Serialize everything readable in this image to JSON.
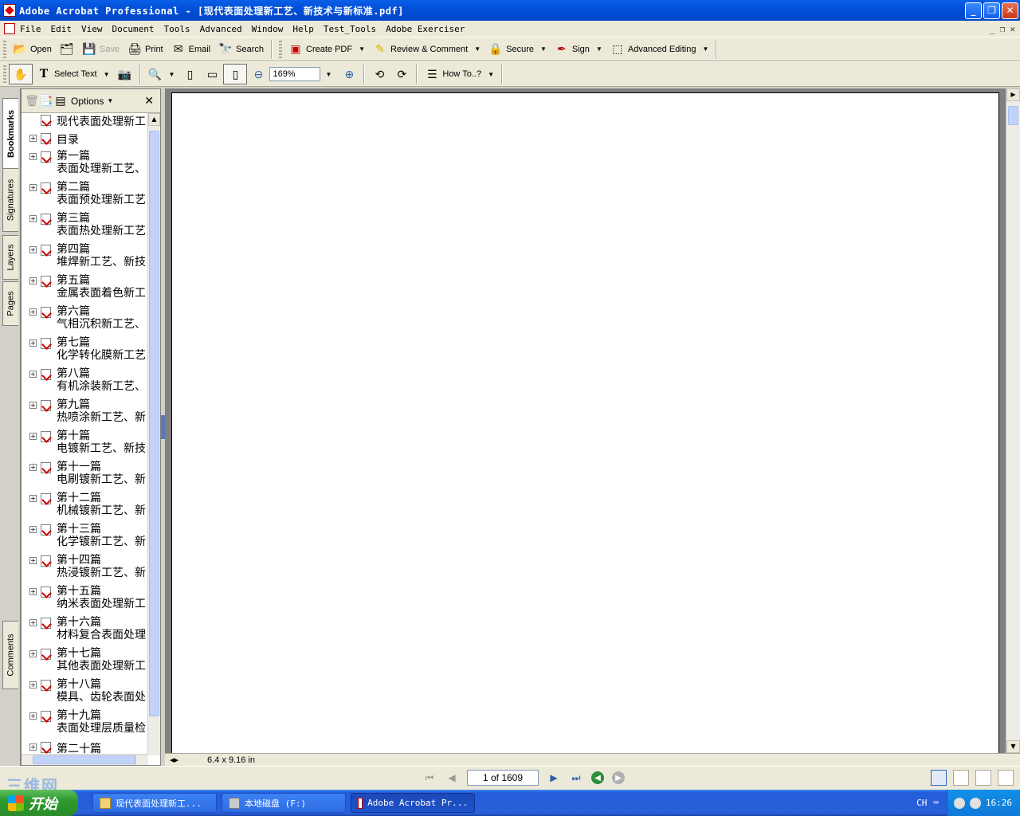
{
  "window": {
    "title": "Adobe Acrobat Professional - [现代表面处理新工艺、新技术与新标准.pdf]",
    "minimize": "_",
    "maximize": "❐",
    "close": "✕"
  },
  "menu": {
    "items": [
      "File",
      "Edit",
      "View",
      "Document",
      "Tools",
      "Advanced",
      "Window",
      "Help",
      "Test_Tools",
      "Adobe Exerciser"
    ],
    "mdi_buttons": [
      "_",
      "❐",
      "✕"
    ]
  },
  "toolbar1": {
    "open": "Open",
    "save": "Save",
    "print": "Print",
    "email": "Email",
    "search": "Search",
    "create_pdf": "Create PDF",
    "review_comment": "Review & Comment",
    "secure": "Secure",
    "sign": "Sign",
    "advanced_editing": "Advanced Editing"
  },
  "toolbar2": {
    "select_text": "Select Text",
    "zoom_value": "169%",
    "how_to": "How To..?"
  },
  "nav_tabs": [
    "Bookmarks",
    "Signatures",
    "Layers",
    "Pages",
    "Comments"
  ],
  "bookmarks_panel": {
    "options": "Options",
    "close": "✕",
    "items": [
      {
        "line1": "现代表面处理新工",
        "line2": ""
      },
      {
        "line1": "目录",
        "line2": ""
      },
      {
        "line1": "第一篇",
        "line2": "表面处理新工艺、"
      },
      {
        "line1": "第二篇",
        "line2": "表面预处理新工艺"
      },
      {
        "line1": "第三篇",
        "line2": "表面热处理新工艺"
      },
      {
        "line1": "第四篇",
        "line2": "堆焊新工艺、新技"
      },
      {
        "line1": "第五篇",
        "line2": "金属表面着色新工"
      },
      {
        "line1": "第六篇",
        "line2": "气相沉积新工艺、"
      },
      {
        "line1": "第七篇",
        "line2": "化学转化膜新工艺"
      },
      {
        "line1": "第八篇",
        "line2": "有机涂装新工艺、"
      },
      {
        "line1": "第九篇",
        "line2": "热喷涂新工艺、新"
      },
      {
        "line1": "第十篇",
        "line2": "电镀新工艺、新技"
      },
      {
        "line1": "第十一篇",
        "line2": "电刷镀新工艺、新"
      },
      {
        "line1": "第十二篇",
        "line2": "机械镀新工艺、新"
      },
      {
        "line1": "第十三篇",
        "line2": "化学镀新工艺、新"
      },
      {
        "line1": "第十四篇",
        "line2": "热浸镀新工艺、新"
      },
      {
        "line1": "第十五篇",
        "line2": "纳米表面处理新工"
      },
      {
        "line1": "第十六篇",
        "line2": "材料复合表面处理"
      },
      {
        "line1": "第十七篇",
        "line2": "其他表面处理新工"
      },
      {
        "line1": "第十八篇",
        "line2": "模具、齿轮表面处"
      },
      {
        "line1": "第十九篇",
        "line2": "表面处理层质量检"
      },
      {
        "line1": "第二十篇",
        "line2": ""
      }
    ]
  },
  "document": {
    "page_size": "6.4 x 9.16 in"
  },
  "status": {
    "page_indicator": "1 of 1609",
    "watermark": "三维网"
  },
  "taskbar": {
    "start": "开始",
    "tasks": [
      "现代表面处理新工...",
      "本地磁盘 (F:)",
      "Adobe Acrobat Pr..."
    ],
    "ime": "CH",
    "clock": "16:26"
  }
}
